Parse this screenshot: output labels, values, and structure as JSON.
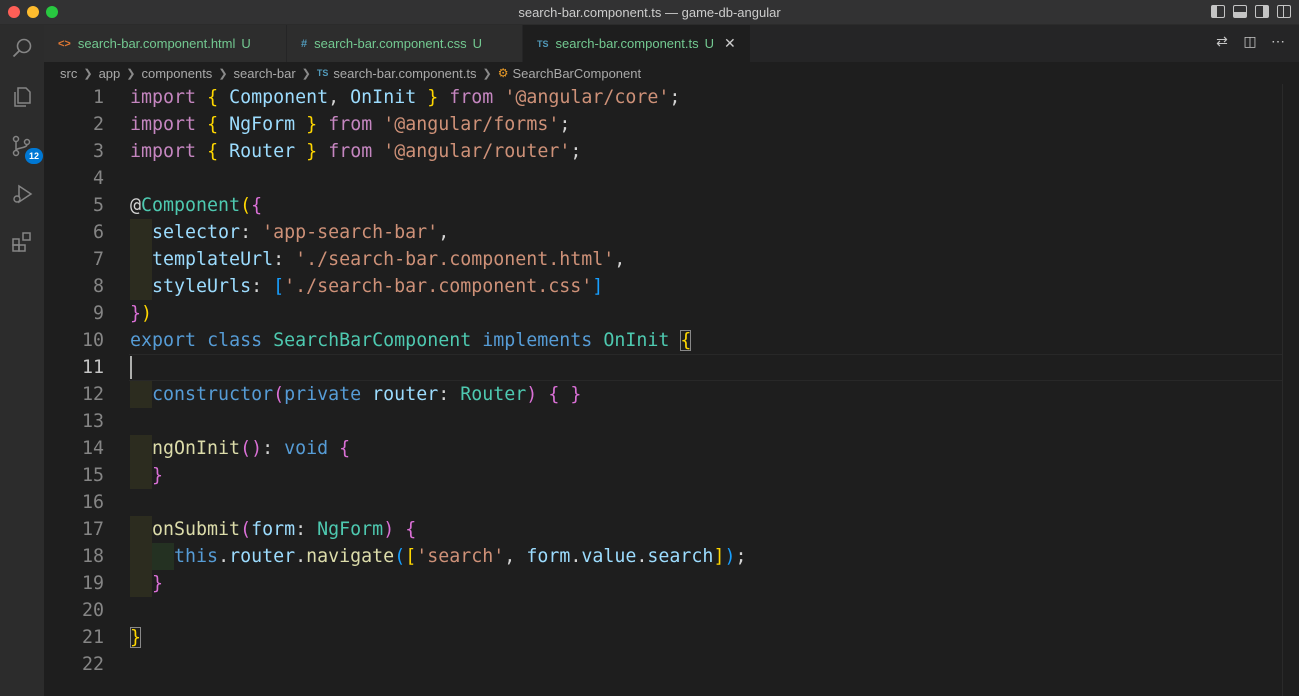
{
  "window": {
    "title": "search-bar.component.ts — game-db-angular"
  },
  "activity": {
    "source_control_badge": "12"
  },
  "tabs": [
    {
      "icon": "<>",
      "name": "search-bar.component.html",
      "status": "U"
    },
    {
      "icon": "#",
      "name": "search-bar.component.css",
      "status": "U"
    },
    {
      "icon": "TS",
      "name": "search-bar.component.ts",
      "status": "U"
    }
  ],
  "breadcrumbs": [
    "src",
    "app",
    "components",
    "search-bar",
    "search-bar.component.ts",
    "SearchBarComponent"
  ],
  "breadcrumb_file_icon": "TS",
  "colors": {
    "keyword_control": "#c586c0",
    "keyword": "#569cd6",
    "variable": "#9cdcfe",
    "type": "#4ec9b0",
    "function": "#dcdcaa",
    "string": "#ce9178",
    "untracked": "#73c991",
    "badge": "#0078d4"
  },
  "code_lines": [
    {
      "n": "1",
      "parts": [
        [
          "k",
          "import"
        ],
        [
          "p",
          " "
        ],
        [
          "br1",
          "{"
        ],
        [
          "p",
          " "
        ],
        [
          "v",
          "Component"
        ],
        [
          "p",
          ", "
        ],
        [
          "v",
          "OnInit"
        ],
        [
          "p",
          " "
        ],
        [
          "br1",
          "}"
        ],
        [
          "p",
          " "
        ],
        [
          "k",
          "from"
        ],
        [
          "p",
          " "
        ],
        [
          "s",
          "'@angular/core'"
        ],
        [
          "p",
          ";"
        ]
      ]
    },
    {
      "n": "2",
      "parts": [
        [
          "k",
          "import"
        ],
        [
          "p",
          " "
        ],
        [
          "br1",
          "{"
        ],
        [
          "p",
          " "
        ],
        [
          "v",
          "NgForm"
        ],
        [
          "p",
          " "
        ],
        [
          "br1",
          "}"
        ],
        [
          "p",
          " "
        ],
        [
          "k",
          "from"
        ],
        [
          "p",
          " "
        ],
        [
          "s",
          "'@angular/forms'"
        ],
        [
          "p",
          ";"
        ]
      ]
    },
    {
      "n": "3",
      "parts": [
        [
          "k",
          "import"
        ],
        [
          "p",
          " "
        ],
        [
          "br1",
          "{"
        ],
        [
          "p",
          " "
        ],
        [
          "v",
          "Router"
        ],
        [
          "p",
          " "
        ],
        [
          "br1",
          "}"
        ],
        [
          "p",
          " "
        ],
        [
          "k",
          "from"
        ],
        [
          "p",
          " "
        ],
        [
          "s",
          "'@angular/router'"
        ],
        [
          "p",
          ";"
        ]
      ]
    },
    {
      "n": "4",
      "parts": []
    },
    {
      "n": "5",
      "parts": [
        [
          "p",
          "@"
        ],
        [
          "t",
          "Component"
        ],
        [
          "br1",
          "("
        ],
        [
          "br2",
          "{"
        ]
      ]
    },
    {
      "n": "6",
      "parts": [
        [
          "p",
          "  "
        ],
        [
          "v",
          "selector"
        ],
        [
          "p",
          ": "
        ],
        [
          "s",
          "'app-search-bar'"
        ],
        [
          "p",
          ","
        ]
      ]
    },
    {
      "n": "7",
      "parts": [
        [
          "p",
          "  "
        ],
        [
          "v",
          "templateUrl"
        ],
        [
          "p",
          ": "
        ],
        [
          "s",
          "'./search-bar.component.html'"
        ],
        [
          "p",
          ","
        ]
      ]
    },
    {
      "n": "8",
      "parts": [
        [
          "p",
          "  "
        ],
        [
          "v",
          "styleUrls"
        ],
        [
          "p",
          ": "
        ],
        [
          "br3",
          "["
        ],
        [
          "s",
          "'./search-bar.component.css'"
        ],
        [
          "br3",
          "]"
        ]
      ]
    },
    {
      "n": "9",
      "parts": [
        [
          "br2",
          "}"
        ],
        [
          "br1",
          ")"
        ]
      ]
    },
    {
      "n": "10",
      "parts": [
        [
          "b",
          "export"
        ],
        [
          "p",
          " "
        ],
        [
          "b",
          "class"
        ],
        [
          "p",
          " "
        ],
        [
          "t",
          "SearchBarComponent"
        ],
        [
          "p",
          " "
        ],
        [
          "b",
          "implements"
        ],
        [
          "p",
          " "
        ],
        [
          "t",
          "OnInit"
        ],
        [
          "p",
          " "
        ],
        [
          "br1 hl",
          "{"
        ]
      ]
    },
    {
      "n": "11",
      "parts": []
    },
    {
      "n": "12",
      "parts": [
        [
          "p",
          "  "
        ],
        [
          "b",
          "constructor"
        ],
        [
          "br2",
          "("
        ],
        [
          "b",
          "private"
        ],
        [
          "p",
          " "
        ],
        [
          "v",
          "router"
        ],
        [
          "p",
          ": "
        ],
        [
          "t",
          "Router"
        ],
        [
          "br2",
          ")"
        ],
        [
          "p",
          " "
        ],
        [
          "br2",
          "{"
        ],
        [
          "p",
          " "
        ],
        [
          "br2",
          "}"
        ]
      ]
    },
    {
      "n": "13",
      "parts": []
    },
    {
      "n": "14",
      "parts": [
        [
          "p",
          "  "
        ],
        [
          "f",
          "ngOnInit"
        ],
        [
          "br2",
          "()"
        ],
        [
          "p",
          ": "
        ],
        [
          "b",
          "void"
        ],
        [
          "p",
          " "
        ],
        [
          "br2",
          "{"
        ]
      ]
    },
    {
      "n": "15",
      "parts": [
        [
          "p",
          "  "
        ],
        [
          "br2",
          "}"
        ]
      ]
    },
    {
      "n": "16",
      "parts": []
    },
    {
      "n": "17",
      "parts": [
        [
          "p",
          "  "
        ],
        [
          "f",
          "onSubmit"
        ],
        [
          "br2",
          "("
        ],
        [
          "v",
          "form"
        ],
        [
          "p",
          ": "
        ],
        [
          "t",
          "NgForm"
        ],
        [
          "br2",
          ")"
        ],
        [
          "p",
          " "
        ],
        [
          "br2",
          "{"
        ]
      ]
    },
    {
      "n": "18",
      "parts": [
        [
          "p",
          "    "
        ],
        [
          "b",
          "this"
        ],
        [
          "p",
          "."
        ],
        [
          "v",
          "router"
        ],
        [
          "p",
          "."
        ],
        [
          "f",
          "navigate"
        ],
        [
          "br3",
          "("
        ],
        [
          "br1",
          "["
        ],
        [
          "s",
          "'search'"
        ],
        [
          "p",
          ", "
        ],
        [
          "v",
          "form"
        ],
        [
          "p",
          "."
        ],
        [
          "v",
          "value"
        ],
        [
          "p",
          "."
        ],
        [
          "v",
          "search"
        ],
        [
          "br1",
          "]"
        ],
        [
          "br3",
          ")"
        ],
        [
          "p",
          ";"
        ]
      ]
    },
    {
      "n": "19",
      "parts": [
        [
          "p",
          "  "
        ],
        [
          "br2",
          "}"
        ]
      ]
    },
    {
      "n": "20",
      "parts": []
    },
    {
      "n": "21",
      "parts": [
        [
          "br1 hl",
          "}"
        ]
      ]
    },
    {
      "n": "22",
      "parts": []
    }
  ]
}
